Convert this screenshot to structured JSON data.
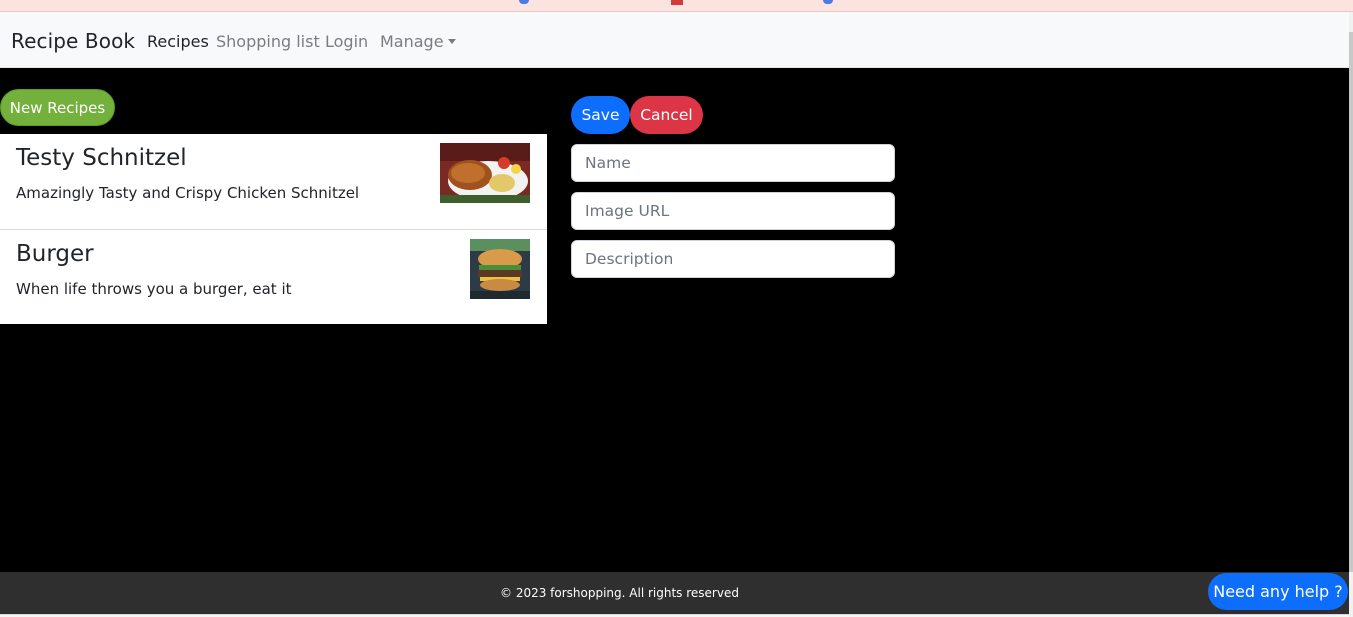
{
  "navbar": {
    "brand": "Recipe Book",
    "links": [
      {
        "label": "Recipes",
        "active": true
      },
      {
        "label": "Shopping list",
        "active": false
      },
      {
        "label": "Login",
        "active": false
      },
      {
        "label": "Manage",
        "active": false
      }
    ]
  },
  "actions": {
    "new_recipe_label": "New Recipes",
    "save_label": "Save",
    "cancel_label": "Cancel"
  },
  "recipes": [
    {
      "title": "Testy Schnitzel",
      "description": "Amazingly Tasty and Crispy Chicken Schnitzel"
    },
    {
      "title": "Burger",
      "description": "When life throws you a burger, eat it"
    }
  ],
  "form": {
    "name_placeholder": "Name",
    "image_url_placeholder": "Image URL",
    "description_placeholder": "Description"
  },
  "footer": {
    "text": "© 2023 forshopping. All rights reserved"
  },
  "help": {
    "label": "Need any help ?"
  },
  "colors": {
    "primary": "#0d6efd",
    "danger": "#dc3545",
    "success": "#73b03c",
    "background": "#000000",
    "footer": "#2f2f2f"
  }
}
